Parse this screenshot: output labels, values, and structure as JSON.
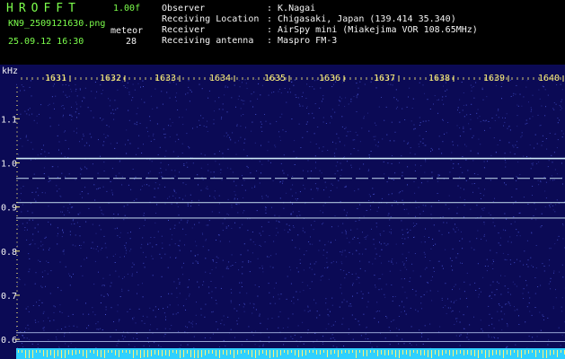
{
  "header": {
    "app_name": "HROFFT",
    "version": "1.00f",
    "filename": "KN9_2509121630.png",
    "datetime": "25.09.12 16:30",
    "meteor_label": "meteor",
    "meteor_count": "28",
    "info": [
      {
        "label": "Observer",
        "value": ": K.Nagai"
      },
      {
        "label": "Receiving Location",
        "value": ": Chigasaki, Japan (139.414 35.340)"
      },
      {
        "label": "Receiver",
        "value": ": AirSpy mini (Miakejima VOR 108.65MHz)"
      },
      {
        "label": "Receiving antenna",
        "value": ": Maspro FM-3"
      }
    ]
  },
  "chart_data": {
    "type": "heatmap",
    "xlabel": "",
    "ylabel": "kHz",
    "x_ticks": [
      "1631",
      "1632",
      "1633",
      "1634",
      "1635",
      "1636",
      "1637",
      "1638",
      "1639",
      "1640"
    ],
    "y_unit": "kHz",
    "y_ticks": [
      "1.1",
      "1.0",
      "0.9",
      "0.8",
      "0.7",
      "0.6"
    ],
    "ylim": [
      0.58,
      1.19
    ],
    "horizontal_lines_khz": [
      1.01,
      0.965,
      0.91,
      0.875
    ],
    "baseline_lines_khz": [
      0.615,
      0.595
    ],
    "colors": {
      "background": "#0b0a55",
      "noise": "#4b58d8",
      "signal": "#d8f4ff",
      "tick": "#FFF27A",
      "floor": "#2fd0ff"
    }
  }
}
